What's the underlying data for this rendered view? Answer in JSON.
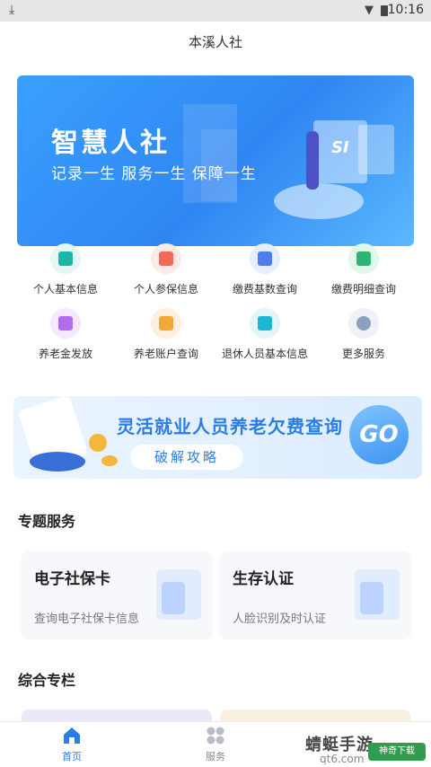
{
  "status_bar": {
    "time": "10:16",
    "download_icon": "download-icon",
    "wifi_icon": "wifi-icon",
    "battery_icon": "battery-icon"
  },
  "header": {
    "title": "本溪人社"
  },
  "banner": {
    "title": "智慧人社",
    "subtitle": "记录一生  服务一生  保障一生",
    "logo_text": "SI",
    "colors": {
      "start": "#3aa0ff",
      "end": "#2f86f2"
    }
  },
  "quick_services": [
    {
      "label": "个人基本信息",
      "icon": "profile-card-icon",
      "color": "#1cb6a6"
    },
    {
      "label": "个人参保信息",
      "icon": "insurance-doc-icon",
      "color": "#f26b5a"
    },
    {
      "label": "缴费基数查询",
      "icon": "yuan-calculator-icon",
      "color": "#4c7ef0"
    },
    {
      "label": "缴费明细查询",
      "icon": "plus-list-icon",
      "color": "#2bb673"
    },
    {
      "label": "养老金发放",
      "icon": "pension-icon",
      "color": "#b36bf0"
    },
    {
      "label": "养老账户查询",
      "icon": "account-icon",
      "color": "#f2a93b"
    },
    {
      "label": "退休人员基本信息",
      "icon": "retiree-card-icon",
      "color": "#1cb6d0"
    },
    {
      "label": "更多服务",
      "icon": "more-grid-icon",
      "color": "#8fa0bd"
    }
  ],
  "promo": {
    "title": "灵活就业人员养老欠费查询",
    "button_label": "破解攻略",
    "go_label": "GO"
  },
  "topic_section": {
    "title": "专题服务",
    "cards": [
      {
        "title": "电子社保卡",
        "subtitle": "查询电子社保卡信息"
      },
      {
        "title": "生存认证",
        "subtitle": "人脸识别及时认证"
      }
    ]
  },
  "column_section": {
    "title": "综合专栏"
  },
  "tab_bar": {
    "tabs": [
      {
        "label": "首页",
        "icon": "home-icon",
        "active": true
      },
      {
        "label": "服务",
        "icon": "grid-icon",
        "active": false
      }
    ],
    "accent": "#2b7de6"
  },
  "watermark": {
    "text": "蜻蜓手游",
    "badge": "神奇下载",
    "url": "qt6.com"
  }
}
